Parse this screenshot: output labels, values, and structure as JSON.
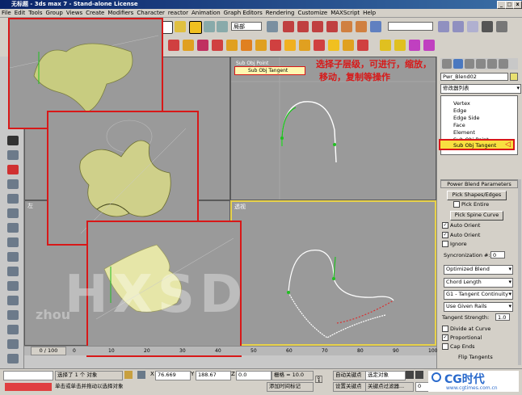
{
  "window": {
    "title": "无标题 - 3ds max 7 - Stand-alone License",
    "min_label": "_",
    "max_label": "□",
    "close_label": "x"
  },
  "menu": {
    "items": [
      "File",
      "Edit",
      "Tools",
      "Group",
      "Views",
      "Create",
      "Modifiers",
      "Character",
      "reactor",
      "Animation",
      "Graph Editors",
      "Rendering",
      "Customize",
      "MAXScript",
      "Help"
    ]
  },
  "toolbar": {
    "view_dropdown": "局部"
  },
  "viewports": {
    "top_label": "顶",
    "left_label": "左",
    "persp_label": "透视",
    "subobj_current": "Sub Obj Point",
    "subobj_selected": "Sub Obj Tangent"
  },
  "annotation": {
    "line1": "选择子层级，可进行，缩放，",
    "line2": "移动，复制等操作"
  },
  "watermark": {
    "text": "HXSD",
    "sub": "zhou"
  },
  "command_panel": {
    "object_name": "Pwr_Blend02",
    "modifier_list": "修改器列表",
    "stack_items": [
      "Vertex",
      "Edge",
      "Edge Side",
      "Face",
      "Element",
      "Sub Obj Point",
      "Sub Obj Tangent"
    ],
    "rollout_title": "Power Blend Parameters",
    "pick_shapes_label": "Pick Shapes/Edges",
    "pick_entire_label": "Pick Entire",
    "pick_spine_label": "Pick Spine Curve",
    "auto_orient_1": "Auto Orient",
    "auto_orient_2": "Auto Orient",
    "ignore_label": "Ignore",
    "sync_label": "Syncronization #:",
    "sync_value": "0",
    "blend_dropdown": "Optimized Blend",
    "chord_dropdown": "Chord Length",
    "continuity_dropdown": "G1 - Tangent Continuity",
    "rails_dropdown": "Use Given Rails",
    "tangent_strength_label": "Tangent Strength:",
    "tangent_strength_value": "1.0",
    "divide_label": "Divide at Curve",
    "proportional_label": "Proportional",
    "cap_ends_label": "Cap Ends",
    "flip_tangents_label": "Flip Tangents"
  },
  "timeline": {
    "frame_label": "0 / 100",
    "ticks": [
      "0",
      "10",
      "20",
      "30",
      "40",
      "50",
      "60",
      "70",
      "80",
      "90",
      "100"
    ]
  },
  "status": {
    "selection_text": "选择了 1 个 对象",
    "prompt_text": "单击或单击并拖动以选择对象",
    "x_label": "X",
    "x_value": "76.669",
    "y_label": "Y",
    "y_value": "188.67",
    "z_label": "Z",
    "z_value": "0.0",
    "grid_text": "栅格 = 10.0",
    "add_time_tag": "添加时间标记",
    "auto_key": "自动关键点",
    "set_key": "设置关键点",
    "selected_object": "选定对象",
    "key_filters": "关键点过滤器...",
    "frame_value": "0"
  },
  "logo": {
    "text": "CG时代",
    "url": "www.cgtimes.com.cn"
  }
}
